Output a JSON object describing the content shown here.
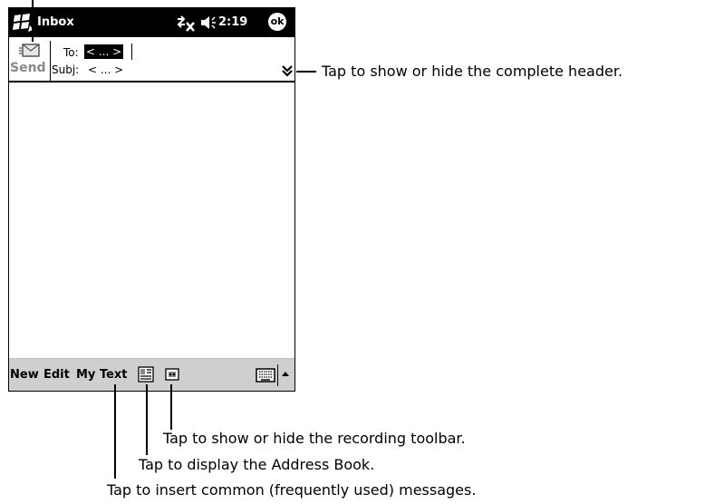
{
  "window": {
    "title": "Inbox",
    "clock": "2:19",
    "ok_label": "ok"
  },
  "header": {
    "send_label": "Send",
    "to_label": "To:",
    "to_value": "< ... >",
    "subj_label": "Subj:",
    "subj_value": "< ... >"
  },
  "menubar": {
    "items": [
      "New",
      "Edit",
      "My Text"
    ]
  },
  "callouts": {
    "header_toggle": "Tap to show or hide the complete header.",
    "recording_toolbar": "Tap to show or hide the recording toolbar.",
    "address_book": "Tap to display the Address Book.",
    "my_text": "Tap to insert common (frequently used) messages."
  },
  "colors": {
    "titlebar": "#000000",
    "menubar": "#cfcfcf",
    "send_label": "#8a8a8a",
    "screen_bg": "#ffffff"
  },
  "icons": [
    "windows-start-icon",
    "connectivity-icon",
    "speaker-icon",
    "send-envelope-icon",
    "double-chevron-down-icon",
    "address-book-icon",
    "recording-toolbar-icon",
    "keyboard-icon",
    "up-arrow-icon"
  ]
}
